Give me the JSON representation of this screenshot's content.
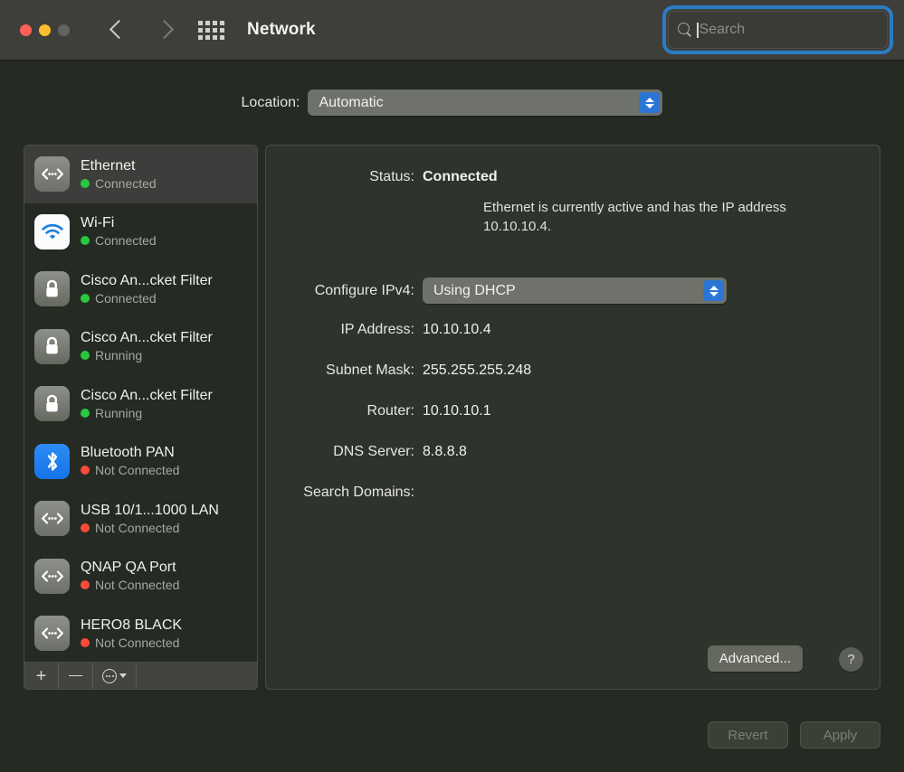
{
  "window": {
    "title": "Network",
    "traffic_lights": [
      "close",
      "minimize",
      "zoom"
    ],
    "back_label": "Back",
    "forward_label": "Forward",
    "grid_label": "Show All"
  },
  "search": {
    "placeholder": "Search",
    "value": "",
    "icon": "search-icon",
    "focused": true,
    "focus_ring_color": "#2b7cc4"
  },
  "location": {
    "label": "Location:",
    "selected": "Automatic",
    "options": [
      "Automatic"
    ]
  },
  "services": [
    {
      "name": "Ethernet",
      "status": "Connected",
      "state": "green",
      "icon": "ethernet-icon",
      "selected": true
    },
    {
      "name": "Wi-Fi",
      "status": "Connected",
      "state": "green",
      "icon": "wifi-icon",
      "selected": false
    },
    {
      "name": "Cisco An...cket Filter",
      "status": "Connected",
      "state": "green",
      "icon": "lock-icon",
      "selected": false
    },
    {
      "name": "Cisco An...cket Filter",
      "status": "Running",
      "state": "green",
      "icon": "lock-icon",
      "selected": false
    },
    {
      "name": "Cisco An...cket Filter",
      "status": "Running",
      "state": "green",
      "icon": "lock-icon",
      "selected": false
    },
    {
      "name": "Bluetooth PAN",
      "status": "Not Connected",
      "state": "red",
      "icon": "bluetooth-icon",
      "selected": false
    },
    {
      "name": "USB 10/1...1000 LAN",
      "status": "Not Connected",
      "state": "red",
      "icon": "ethernet-icon",
      "selected": false
    },
    {
      "name": "QNAP QA Port",
      "status": "Not Connected",
      "state": "red",
      "icon": "ethernet-icon",
      "selected": false
    },
    {
      "name": "HERO8 BLACK",
      "status": "Not Connected",
      "state": "red",
      "icon": "ethernet-icon",
      "selected": false
    }
  ],
  "list_toolbar": {
    "add_label": "+",
    "remove_label": "−",
    "actions_icon": "ellipsis-circle-icon",
    "actions_chevron_icon": "chevron-down-icon"
  },
  "detail": {
    "status_label": "Status:",
    "status_value": "Connected",
    "description": "Ethernet is currently active and has the IP address 10.10.10.4.",
    "configure_label": "Configure IPv4:",
    "configure_value": "Using DHCP",
    "configure_options": [
      "Using DHCP"
    ],
    "ip_label": "IP Address:",
    "ip_value": "10.10.10.4",
    "subnet_label": "Subnet Mask:",
    "subnet_value": "255.255.255.248",
    "router_label": "Router:",
    "router_value": "10.10.10.1",
    "dns_label": "DNS Server:",
    "dns_value": "8.8.8.8",
    "domains_label": "Search Domains:",
    "domains_value": "",
    "advanced_label": "Advanced...",
    "help_label": "?"
  },
  "footer": {
    "revert_label": "Revert",
    "apply_label": "Apply",
    "revert_enabled": false,
    "apply_enabled": false
  },
  "colors": {
    "titlebar": "#3e3e3b",
    "body": "#252a22",
    "panel": "#2e332b",
    "selection": "#3d3d3b",
    "accent_blue": "#2b76d4",
    "status_green": "#28c93f",
    "status_red": "#fa4a39"
  }
}
